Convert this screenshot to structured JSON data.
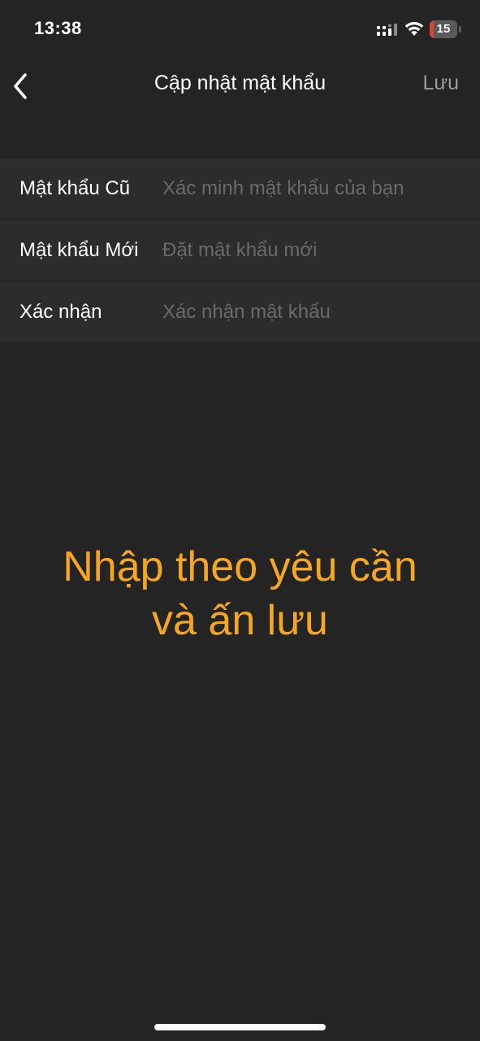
{
  "status_bar": {
    "time": "13:38",
    "battery_level": "15",
    "battery_fraction": 0.15,
    "battery_color": "#e0403a",
    "icons": [
      "signal-icon",
      "wifi-icon",
      "battery-icon"
    ]
  },
  "nav": {
    "back_icon": "chevron-left-icon",
    "title": "Cập nhật mật khẩu",
    "save_label": "Lưu"
  },
  "form": {
    "fields": [
      {
        "label": "Mật khẩu Cũ",
        "placeholder": "Xác minh mật khẩu của bạn",
        "value": ""
      },
      {
        "label": "Mật khẩu Mới",
        "placeholder": "Đặt mật khẩu mới",
        "value": ""
      },
      {
        "label": "Xác nhận",
        "placeholder": "Xác nhận mật khẩu",
        "value": ""
      }
    ]
  },
  "annotation": {
    "line1": "Nhập theo yêu cần",
    "line2": "và ấn lưu",
    "color": "#f5a623"
  },
  "colors": {
    "background": "#242424",
    "row_background": "#2c2c2c",
    "save_text": "#9a9a9a",
    "placeholder": "#6a6a6a"
  }
}
